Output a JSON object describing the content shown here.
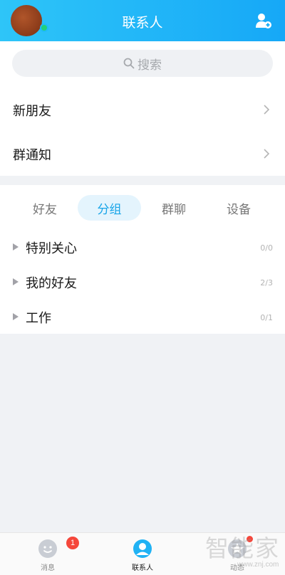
{
  "header": {
    "title": "联系人",
    "avatar_icon": "avatar",
    "add_icon": "add-contact-icon",
    "colors": {
      "gradient_start": "#2ec5f8",
      "gradient_end": "#16a8f7"
    }
  },
  "search": {
    "placeholder": "搜索",
    "icon": "search-icon"
  },
  "entries": [
    {
      "label": "新朋友"
    },
    {
      "label": "群通知"
    }
  ],
  "tabs": [
    {
      "label": "好友",
      "active": false
    },
    {
      "label": "分组",
      "active": true
    },
    {
      "label": "群聊",
      "active": false
    },
    {
      "label": "设备",
      "active": false
    }
  ],
  "groups": [
    {
      "name": "特别关心",
      "count": "0/0"
    },
    {
      "name": "我的好友",
      "count": "2/3"
    },
    {
      "name": "工作",
      "count": "0/1"
    }
  ],
  "tabbar": [
    {
      "label": "消息",
      "badge": "1",
      "icon": "message-icon"
    },
    {
      "label": "联系人",
      "icon": "contacts-icon",
      "active": true
    },
    {
      "label": "动态",
      "icon": "feed-icon",
      "dot": true
    }
  ],
  "watermark": {
    "text": "智能家",
    "url": "www.znj.com"
  },
  "accent": "#16a4e8"
}
